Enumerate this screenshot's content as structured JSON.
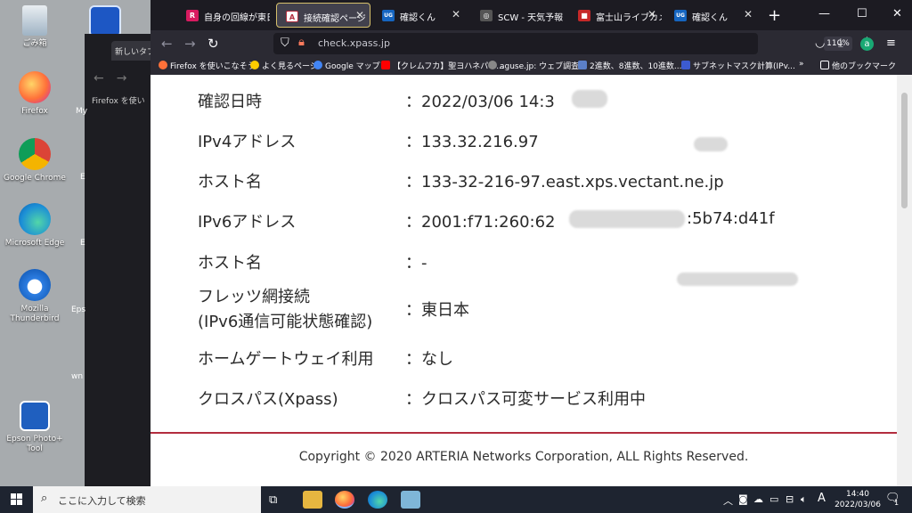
{
  "desktop": {
    "icons": [
      {
        "label": "ごみ箱"
      },
      {
        "label": "Firefox"
      },
      {
        "label": "Google Chrome"
      },
      {
        "label": "Microsoft Edge"
      },
      {
        "label": "Mozilla Thunderbird"
      },
      {
        "label": "Epson Photo+ Tool"
      }
    ],
    "bg_window": {
      "tab_label": "新しいタブ",
      "bookmark": "Firefox を使い",
      "side_labels": [
        "My",
        "E",
        "E",
        "Eps",
        "wn"
      ]
    }
  },
  "browser": {
    "tabs": [
      {
        "title": "自身の回線が東日本",
        "fav": "R",
        "fav_color": "#d81b60"
      },
      {
        "title": "接続確認ページ",
        "fav": "A",
        "fav_color": "#b32d3e",
        "active": true
      },
      {
        "title": "確認くん",
        "fav": "UG",
        "fav_color": "#1565c0"
      },
      {
        "title": "SCW - 天気予報",
        "fav": "◎",
        "fav_color": "#555555"
      },
      {
        "title": "富士山ライブカメラ",
        "fav": "■",
        "fav_color": "#c62828"
      },
      {
        "title": "確認くん",
        "fav": "UG",
        "fav_color": "#1565c0"
      }
    ],
    "url": "check.xpass.jp",
    "zoom": "110%",
    "bookmarks": [
      {
        "label": "Firefox を使いこなそう",
        "color": "#ff7139"
      },
      {
        "label": "よく見るページ",
        "color": "#ffcc00"
      },
      {
        "label": "Google マップ",
        "color": "#4285f4"
      },
      {
        "label": "【クレムフカ】聖ヨハネパウ...",
        "color": "#ff0000"
      },
      {
        "label": "aguse.jp: ウェブ調査",
        "color": "#888888"
      },
      {
        "label": "2進数、8進数、10進数...",
        "color": "#5b7fc7"
      },
      {
        "label": "サブネットマスク計算(IPv...",
        "color": "#3c5bd1"
      }
    ],
    "other_bookmarks": "他のブックマーク"
  },
  "content": {
    "rows": [
      {
        "label": "確認日時",
        "value": "：2022/03/06 14:3"
      },
      {
        "label": "IPv4アドレス",
        "value": "：133.32.216.97"
      },
      {
        "label": "ホスト名",
        "value": "：133-32-216-97.east.xps.vectant.ne.jp"
      },
      {
        "label": "IPv6アドレス",
        "value": "：2001:f71:260:62",
        "value_tail": ":5b74:d41f"
      },
      {
        "label": "ホスト名",
        "value": "：-"
      },
      {
        "label": "フレッツ網接続",
        "label2": "(IPv6通信可能状態確認)",
        "value": "：東日本"
      },
      {
        "label": "ホームゲートウェイ利用",
        "value": "：なし"
      },
      {
        "label": "クロスパス(Xpass)",
        "value": "：クロスパス可変サービス利用中"
      }
    ],
    "copyright": "Copyright © 2020 ARTERIA Networks Corporation, ALL Rights Reserved."
  },
  "taskbar": {
    "search_placeholder": "ここに入力して検索",
    "ime": "A",
    "time": "14:40",
    "date": "2022/03/06",
    "notifications": "1"
  }
}
